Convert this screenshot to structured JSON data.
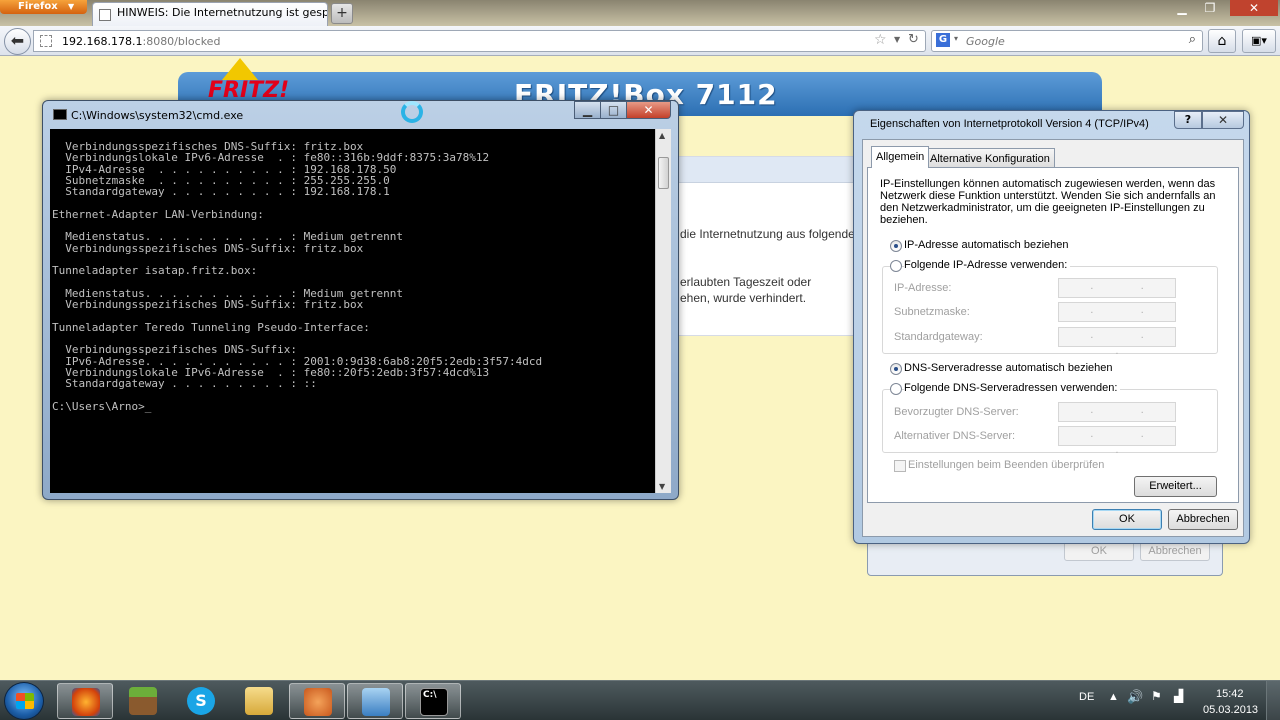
{
  "browser": {
    "menu_label": "Firefox",
    "tab_title": "HINWEIS: Die Internetnutzung ist gesperrt.",
    "new_tab": "+",
    "url_host": "192.168.178.1",
    "url_path": ":8080/blocked",
    "search_placeholder": "Google",
    "search_engine": "G"
  },
  "page": {
    "logo": "FRITZ!",
    "product_title": "FRITZ!Box 7112",
    "text_line1": "die Internetnutzung aus folgende",
    "text_line2": "erlaubten Tageszeit oder",
    "text_line3": "ehen, wurde verhindert."
  },
  "cmd": {
    "title": "C:\\Windows\\system32\\cmd.exe",
    "output": "  Verbindungsspezifisches DNS-Suffix: fritz.box\n  Verbindungslokale IPv6-Adresse  . : fe80::316b:9ddf:8375:3a78%12\n  IPv4-Adresse  . . . . . . . . . . : 192.168.178.50\n  Subnetzmaske  . . . . . . . . . . : 255.255.255.0\n  Standardgateway . . . . . . . . . : 192.168.178.1\n\nEthernet-Adapter LAN-Verbindung:\n\n  Medienstatus. . . . . . . . . . . : Medium getrennt\n  Verbindungsspezifisches DNS-Suffix: fritz.box\n\nTunneladapter isatap.fritz.box:\n\n  Medienstatus. . . . . . . . . . . : Medium getrennt\n  Verbindungsspezifisches DNS-Suffix: fritz.box\n\nTunneladapter Teredo Tunneling Pseudo-Interface:\n\n  Verbindungsspezifisches DNS-Suffix:\n  IPv6-Adresse. . . . . . . . . . . : 2001:0:9d38:6ab8:20f5:2edb:3f57:4dcd\n  Verbindungslokale IPv6-Adresse  . : fe80::20f5:2edb:3f57:4dcd%13\n  Standardgateway . . . . . . . . . : ::\n\nC:\\Users\\Arno>_"
  },
  "dialog": {
    "title": "Eigenschaften von Internetprotokoll Version 4 (TCP/IPv4)",
    "help": "?",
    "tabs": [
      "Allgemein",
      "Alternative Konfiguration"
    ],
    "description_lines": [
      "IP-Einstellungen können automatisch zugewiesen werden, wenn das",
      "Netzwerk diese Funktion unterstützt. Wenden Sie sich andernfalls an",
      "den Netzwerkadministrator, um die geeigneten IP-Einstellungen zu",
      "beziehen."
    ],
    "radio_ip_auto": "IP-Adresse automatisch beziehen",
    "radio_ip_manual": "Folgende IP-Adresse verwenden:",
    "label_ip": "IP-Adresse:",
    "label_subnet": "Subnetzmaske:",
    "label_gateway": "Standardgateway:",
    "radio_dns_auto": "DNS-Serveradresse automatisch beziehen",
    "radio_dns_manual": "Folgende DNS-Serveradressen verwenden:",
    "label_dns_pref": "Bevorzugter DNS-Server:",
    "label_dns_alt": "Alternativer DNS-Server:",
    "ip_placeholder": ". . .",
    "checkbox_validate": "Einstellungen beim Beenden überprüfen",
    "advanced_button": "Erweitert...",
    "ok_button": "OK",
    "cancel_button": "Abbrechen",
    "selected_ip_mode": "auto",
    "selected_dns_mode": "auto"
  },
  "parent_dialog": {
    "ok_button": "OK",
    "cancel_button": "Abbrechen"
  },
  "taskbar": {
    "apps": [
      "firefox-icon",
      "minecraft-icon",
      "skype-icon",
      "explorer-icon",
      "paw-icon",
      "network-icon",
      "cmd-icon"
    ],
    "language": "DE",
    "time": "15:42",
    "date": "05.03.2013"
  }
}
